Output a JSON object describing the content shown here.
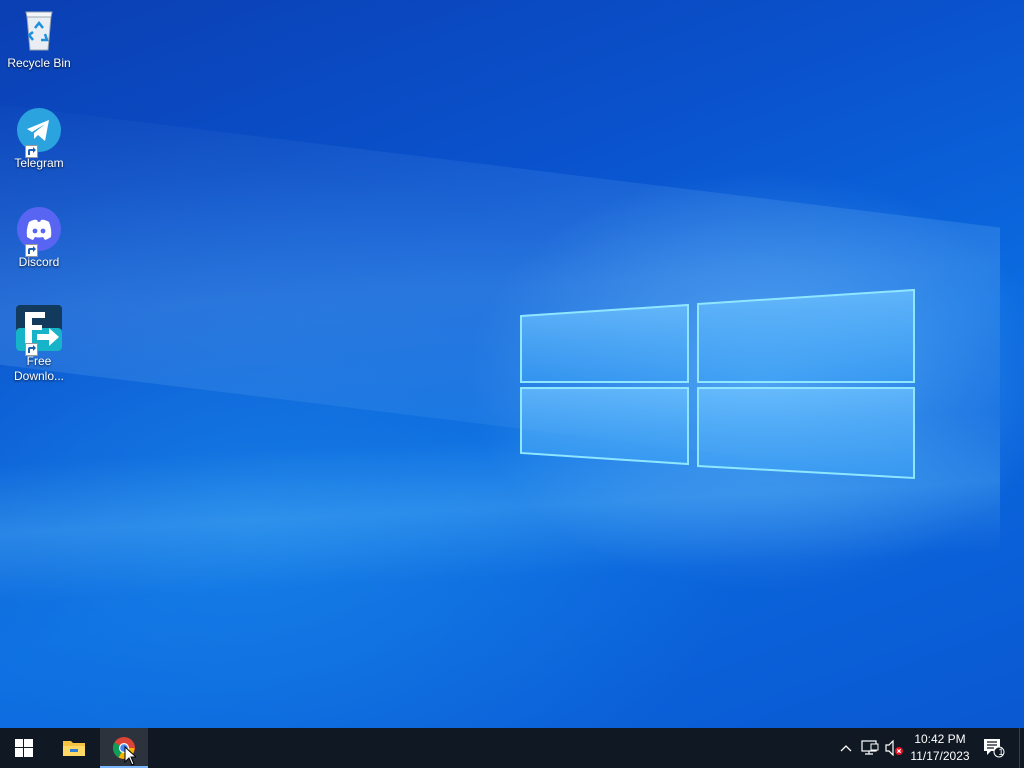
{
  "desktop": {
    "icons": [
      {
        "label": "Recycle Bin",
        "icon": "recycle-bin-icon",
        "shortcut": false
      },
      {
        "label": "Telegram",
        "icon": "telegram-icon",
        "shortcut": true
      },
      {
        "label": "Discord",
        "icon": "discord-icon",
        "shortcut": true
      },
      {
        "label": "Free Downlo...",
        "label_line1": "Free",
        "label_line2": "Downlo...",
        "icon": "free-download-manager-icon",
        "shortcut": true
      }
    ]
  },
  "taskbar": {
    "start_icon": "windows-start-icon",
    "pinned": [
      {
        "icon": "file-explorer-icon"
      },
      {
        "icon": "chrome-icon",
        "active": true
      }
    ],
    "tray": {
      "icons": [
        "chevron-up-icon",
        "network-icon",
        "volume-muted-icon"
      ],
      "time": "10:42 PM",
      "date": "11/17/2023",
      "notifications_count": "1"
    }
  },
  "colors": {
    "taskbar": "#101823",
    "desktop_blue": "#0a5fd0",
    "telegram": "#2aa3df",
    "discord": "#5865f2",
    "chrome_red": "#db4437",
    "chrome_yellow": "#f4b400",
    "chrome_green": "#0f9d58",
    "chrome_blue": "#4285f4"
  }
}
